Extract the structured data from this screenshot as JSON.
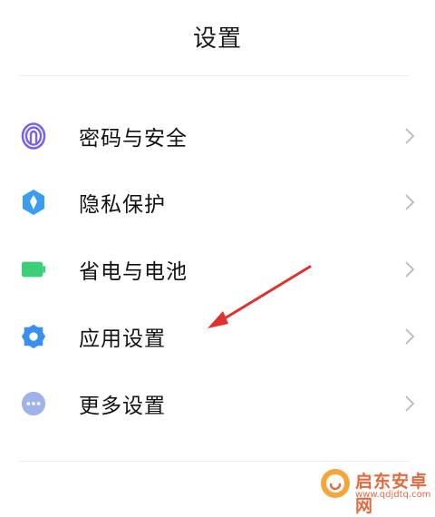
{
  "header": {
    "title": "设置"
  },
  "menu": {
    "items": [
      {
        "label": "密码与安全",
        "icon": "fingerprint-icon",
        "color": "#7b61e6"
      },
      {
        "label": "隐私保护",
        "icon": "privacy-shield-icon",
        "color": "#3a9cf2"
      },
      {
        "label": "省电与电池",
        "icon": "battery-icon",
        "color": "#3ccf7a"
      },
      {
        "label": "应用设置",
        "icon": "gear-icon",
        "color": "#3a8ff0"
      },
      {
        "label": "更多设置",
        "icon": "more-dots-icon",
        "color": "#9fb3e8"
      }
    ]
  },
  "annotation": {
    "arrow_color": "#e0312e"
  },
  "watermark": {
    "text": "启东安卓网",
    "url": "www.qdjdtq.com",
    "color": "#e5683f"
  }
}
